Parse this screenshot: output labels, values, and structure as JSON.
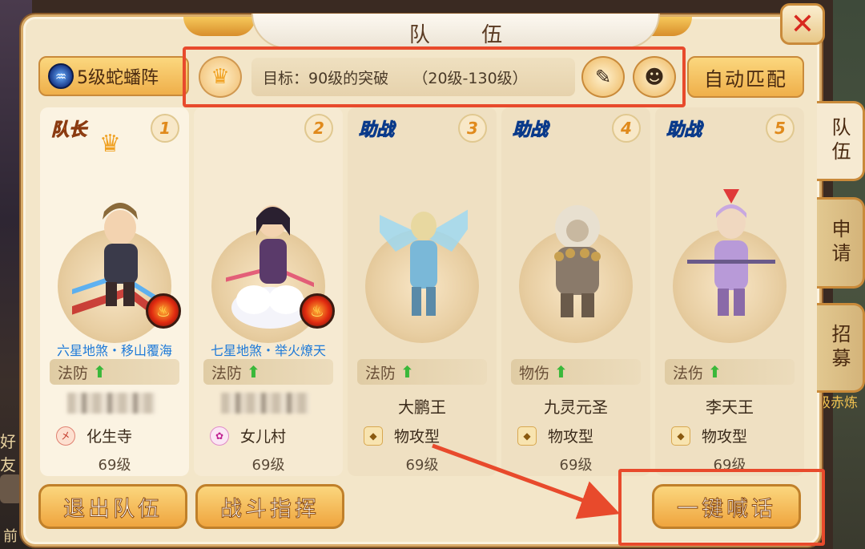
{
  "window": {
    "title": "队 伍",
    "close_symbol": "✕"
  },
  "background": {
    "left_text": "好友",
    "left_bottom_text": "前",
    "right_text": "级赤炼"
  },
  "formation": {
    "label": "5级蛇蟠阵",
    "icon": "formation-icon"
  },
  "target": {
    "text": "目标：90级的突破     （20级-130级）"
  },
  "auto_match_label": "自动匹配",
  "side_tabs": [
    "队伍",
    "申请",
    "招募"
  ],
  "members": [
    {
      "role": "队长",
      "number": "1",
      "skill": "六星地煞・移山覆海",
      "attribute": "法防",
      "name": "",
      "name_hidden": true,
      "sect": "化生寺",
      "sect_icon_char": "㐅",
      "level": "69级",
      "has_crown": true,
      "fire_badge": true
    },
    {
      "role": "",
      "number": "2",
      "skill": "七星地煞・举火燎天",
      "attribute": "法防",
      "name": "",
      "name_hidden": true,
      "sect": "女儿村",
      "sect_icon_char": "✿",
      "level": "69级",
      "has_crown": false,
      "fire_badge": true
    },
    {
      "role": "助战",
      "number": "3",
      "skill": "",
      "attribute": "法防",
      "name": "大鹏王",
      "name_hidden": false,
      "sect": "物攻型",
      "sect_icon_char": "◆",
      "level": "69级",
      "has_crown": false,
      "fire_badge": false
    },
    {
      "role": "助战",
      "number": "4",
      "skill": "",
      "attribute": "物伤",
      "name": "九灵元圣",
      "name_hidden": false,
      "sect": "物攻型",
      "sect_icon_char": "◆",
      "level": "69级",
      "has_crown": false,
      "fire_badge": false
    },
    {
      "role": "助战",
      "number": "5",
      "skill": "",
      "attribute": "法伤",
      "name": "李天王",
      "name_hidden": false,
      "sect": "物攻型",
      "sect_icon_char": "◆",
      "level": "69级",
      "has_crown": false,
      "fire_badge": false
    }
  ],
  "buttons": {
    "leave": "退出队伍",
    "command": "战斗指挥",
    "shout": "一键喊话"
  },
  "colors": {
    "highlight_frame": "#e84a2c",
    "panel_bg": "#f3e6c9",
    "button_gold": "#efaf4a"
  }
}
